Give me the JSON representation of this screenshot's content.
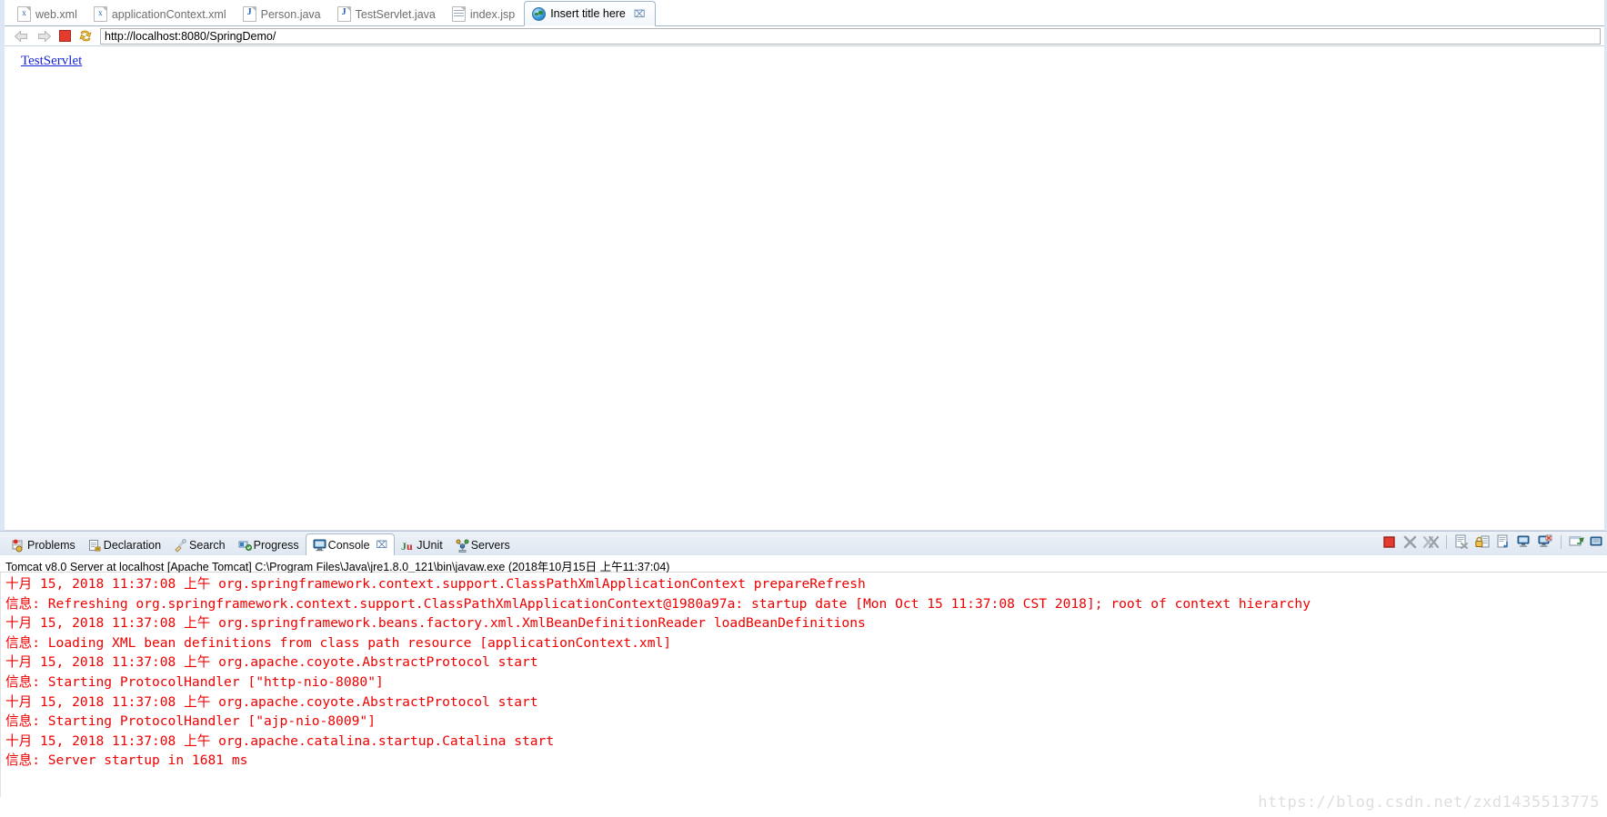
{
  "editor_tabs": [
    {
      "label": "web.xml",
      "icon": "xml-file-icon",
      "active": false,
      "closable": false
    },
    {
      "label": "applicationContext.xml",
      "icon": "xml-file-icon",
      "active": false,
      "closable": false
    },
    {
      "label": "Person.java",
      "icon": "java-file-icon",
      "active": false,
      "closable": false
    },
    {
      "label": "TestServlet.java",
      "icon": "java-file-icon",
      "active": false,
      "closable": false
    },
    {
      "label": "index.jsp",
      "icon": "jsp-file-icon",
      "active": false,
      "closable": false
    },
    {
      "label": "Insert title here",
      "icon": "globe-icon",
      "active": true,
      "closable": true,
      "close_glyph": "⌧"
    }
  ],
  "browser": {
    "back_icon": "back-arrow-icon",
    "forward_icon": "forward-arrow-icon",
    "stop_icon": "stop-icon",
    "refresh_icon": "refresh-icon",
    "url": "http://localhost:8080/SpringDemo/",
    "url_placeholder": "Enter address",
    "page": {
      "link_text": "TestServlet"
    }
  },
  "view_tabs": [
    {
      "label": "Problems",
      "icon": "problems-icon",
      "active": false
    },
    {
      "label": "Declaration",
      "icon": "declaration-icon",
      "active": false
    },
    {
      "label": "Search",
      "icon": "search-icon",
      "active": false
    },
    {
      "label": "Progress",
      "icon": "progress-icon",
      "active": false
    },
    {
      "label": "Console",
      "icon": "console-icon",
      "active": true,
      "close_glyph": "⌧"
    },
    {
      "label": "JUnit",
      "icon": "junit-icon",
      "active": false
    },
    {
      "label": "Servers",
      "icon": "servers-icon",
      "active": false
    }
  ],
  "console_toolbar": [
    {
      "name": "terminate-button",
      "icon": "stop-square-icon"
    },
    {
      "name": "remove-launch-button",
      "icon": "x-gray-icon"
    },
    {
      "name": "remove-all-terminated-button",
      "icon": "double-x-gray-icon"
    },
    {
      "name": "separator-1",
      "icon": "separator"
    },
    {
      "name": "clear-console-button",
      "icon": "clear-page-icon"
    },
    {
      "name": "scroll-lock-button",
      "icon": "lock-icon"
    },
    {
      "name": "show-console-on-output-button",
      "icon": "page-arrow-icon"
    },
    {
      "name": "pin-console-button",
      "icon": "pin-console-icon"
    },
    {
      "name": "display-selected-console-button",
      "icon": "display-console-icon"
    },
    {
      "name": "separator-2",
      "icon": "separator"
    },
    {
      "name": "open-console-button",
      "icon": "open-console-icon"
    },
    {
      "name": "view-menu-button",
      "icon": "view-menu-icon"
    }
  ],
  "console": {
    "header": "Tomcat v8.0 Server at localhost [Apache Tomcat] C:\\Program Files\\Java\\jre1.8.0_121\\bin\\javaw.exe (2018年10月15日 上午11:37:04)",
    "text_color": "#ef0000",
    "lines": [
      "十月 15, 2018 11:37:08 上午 org.springframework.context.support.ClassPathXmlApplicationContext prepareRefresh",
      "信息: Refreshing org.springframework.context.support.ClassPathXmlApplicationContext@1980a97a: startup date [Mon Oct 15 11:37:08 CST 2018]; root of context hierarchy",
      "十月 15, 2018 11:37:08 上午 org.springframework.beans.factory.xml.XmlBeanDefinitionReader loadBeanDefinitions",
      "信息: Loading XML bean definitions from class path resource [applicationContext.xml]",
      "十月 15, 2018 11:37:08 上午 org.apache.coyote.AbstractProtocol start",
      "信息: Starting ProtocolHandler [\"http-nio-8080\"]",
      "十月 15, 2018 11:37:08 上午 org.apache.coyote.AbstractProtocol start",
      "信息: Starting ProtocolHandler [\"ajp-nio-8009\"]",
      "十月 15, 2018 11:37:08 上午 org.apache.catalina.startup.Catalina start",
      "信息: Server startup in 1681 ms"
    ]
  },
  "watermark": "https://blog.csdn.net/zxd1435513775"
}
